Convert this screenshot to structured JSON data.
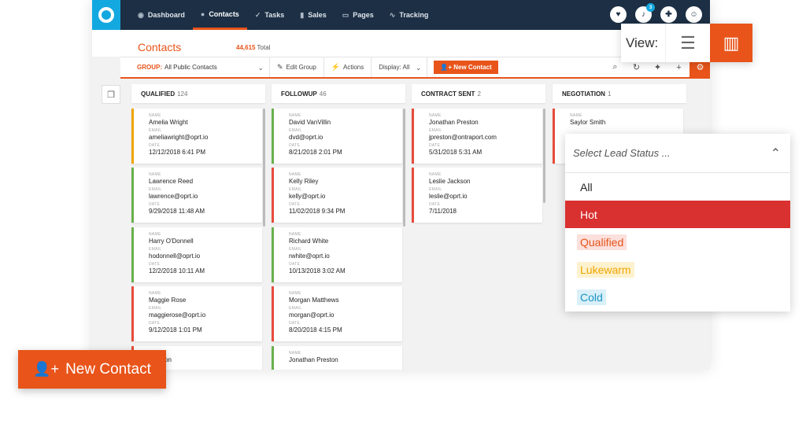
{
  "nav": {
    "items": [
      {
        "label": "Dashboard",
        "icon": "dashboard-icon",
        "glyph": "◉"
      },
      {
        "label": "Contacts",
        "icon": "person-icon",
        "glyph": "●"
      },
      {
        "label": "Tasks",
        "icon": "check-icon",
        "glyph": "✓"
      },
      {
        "label": "Sales",
        "icon": "bar-chart-icon",
        "glyph": "▮"
      },
      {
        "label": "Pages",
        "icon": "page-icon",
        "glyph": "▭"
      },
      {
        "label": "Tracking",
        "icon": "tracking-icon",
        "glyph": "∿"
      }
    ],
    "notification_count": "3"
  },
  "header": {
    "title": "Contacts",
    "total_count": "44,615",
    "total_label": "Total"
  },
  "toolbar": {
    "group_label": "GROUP:",
    "group_value": "All Public Contacts",
    "edit_group": "Edit Group",
    "actions": "Actions",
    "display": "Display: All",
    "new_contact": "New Contact"
  },
  "columns": [
    {
      "title": "QUALIFIED",
      "count": "124",
      "cards": [
        {
          "name": "Amelia Wright",
          "email": "ameliawright@oprt.io",
          "date": "12/12/2018 6:41 PM",
          "color": "#f0a500"
        },
        {
          "name": "Lawrence Reed",
          "email": "lawrence@oprt.io",
          "date": "9/29/2018 11:48 AM",
          "color": "#6ab04c"
        },
        {
          "name": "Harry O'Donnell",
          "email": "hodonnell@oprt.io",
          "date": "12/2/2018 10:11 AM",
          "color": "#6ab04c"
        },
        {
          "name": "Maggie Rose",
          "email": "maggierose@oprt.io",
          "date": "9/12/2018 1:01 PM",
          "color": "#e74c3c"
        },
        {
          "name": "Winston",
          "email": "",
          "date": "",
          "color": "#e74c3c"
        }
      ]
    },
    {
      "title": "FOLLOWUP",
      "count": "46",
      "cards": [
        {
          "name": "David VanVillin",
          "email": "dvd@oprt.io",
          "date": "8/21/2018 2:01 PM",
          "color": "#6ab04c"
        },
        {
          "name": "Kelly Riley",
          "email": "kelly@oprt.io",
          "date": "11/02/2018 9:34 PM",
          "color": "#e74c3c"
        },
        {
          "name": "Richard White",
          "email": "rwhite@oprt.io",
          "date": "10/13/2018 3:02 AM",
          "color": "#6ab04c"
        },
        {
          "name": "Morgan Matthews",
          "email": "morgan@oprt.io",
          "date": "8/20/2018 4:15 PM",
          "color": "#e74c3c"
        },
        {
          "name": "Jonathan Preston",
          "email": "",
          "date": "",
          "color": "#6ab04c"
        }
      ]
    },
    {
      "title": "CONTRACT SENT",
      "count": "2",
      "cards": [
        {
          "name": "Jonathan Preston",
          "email": "jpreston@ontraport.com",
          "date": "5/31/2018 5:31 AM",
          "color": "#e74c3c"
        },
        {
          "name": "Leslie Jackson",
          "email": "leslie@oprt.io",
          "date": "7/11/2018",
          "color": "#e74c3c"
        }
      ]
    },
    {
      "title": "NEGOTIATION",
      "count": "1",
      "cards": [
        {
          "name": "Saylor Smith",
          "email": "",
          "date": "",
          "color": "#e74c3c"
        }
      ]
    }
  ],
  "field_labels": {
    "name": "NAME",
    "email": "EMAIL",
    "date": "DATE"
  },
  "view_switch": {
    "label": "View:"
  },
  "lead_status": {
    "placeholder": "Select Lead Status ...",
    "options": [
      "All",
      "Hot",
      "Qualified",
      "Lukewarm",
      "Cold"
    ]
  },
  "big_button": {
    "label": "New Contact"
  },
  "colors": {
    "accent": "#e8541a",
    "nav_bg": "#1c2f44",
    "brand": "#14a8e0",
    "hot": "#d93030"
  }
}
